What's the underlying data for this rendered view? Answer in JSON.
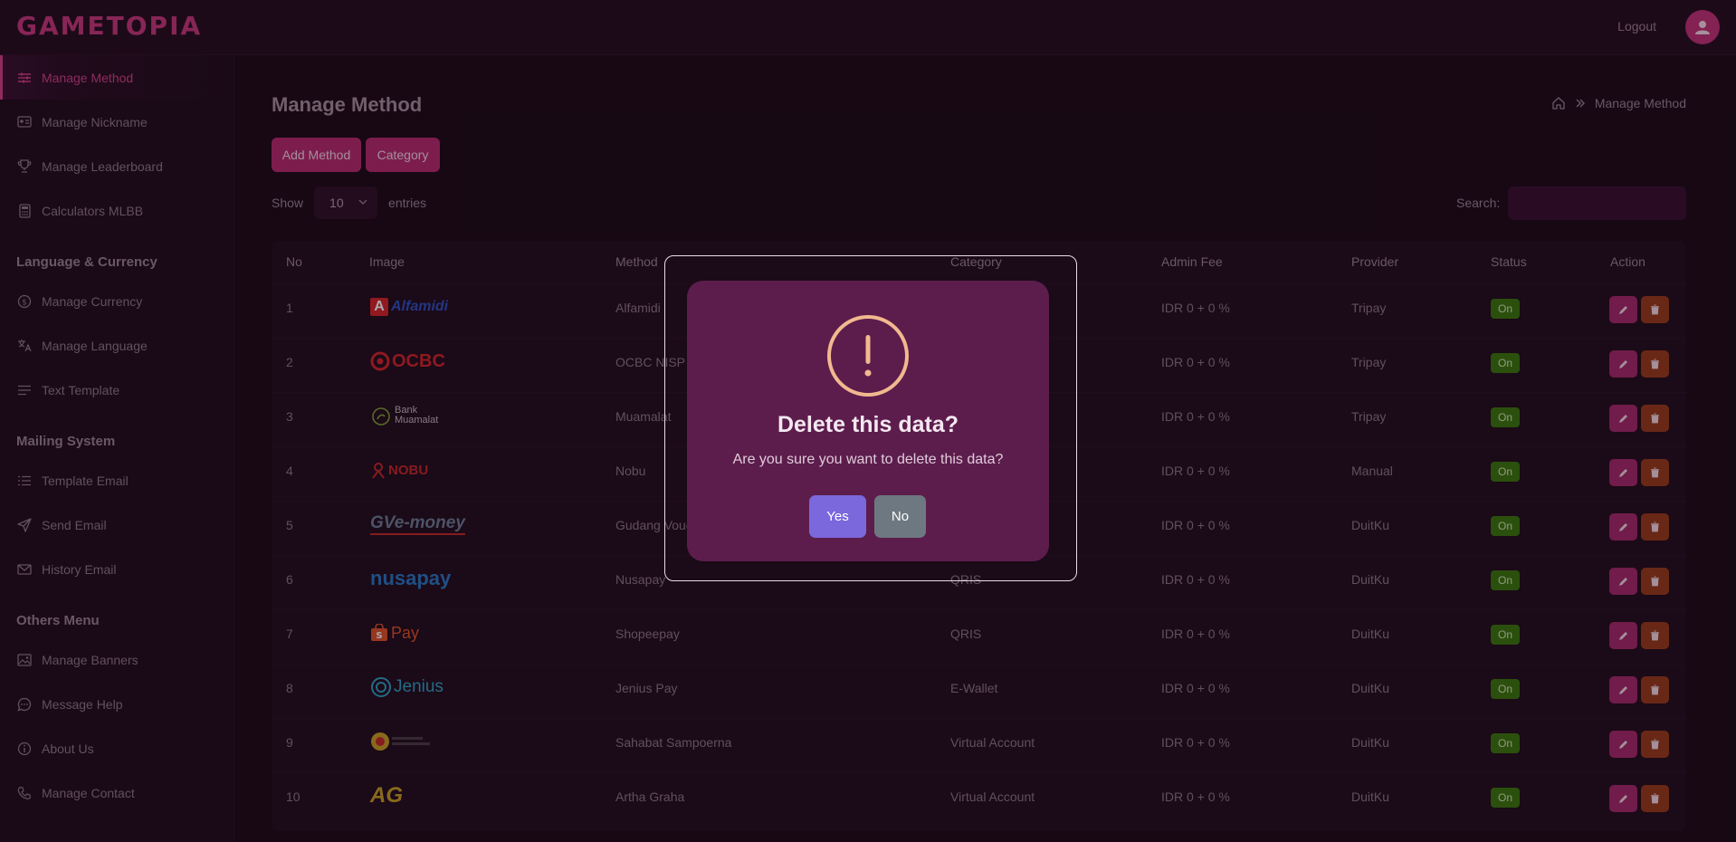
{
  "header": {
    "logo": "GAMETOPIA",
    "logout": "Logout",
    "avatar_icon": "user-icon"
  },
  "sidebar": {
    "items": [
      {
        "label": "Manage Method",
        "icon": "sliders-icon",
        "active": true
      },
      {
        "label": "Manage Nickname",
        "icon": "id-card-icon"
      },
      {
        "label": "Manage Leaderboard",
        "icon": "trophy-icon"
      },
      {
        "label": "Calculators MLBB",
        "icon": "calculator-icon"
      }
    ],
    "section_language": "Language & Currency",
    "language_items": [
      {
        "label": "Manage Currency",
        "icon": "dollar-circle-icon"
      },
      {
        "label": "Manage Language",
        "icon": "translate-icon"
      },
      {
        "label": "Text Template",
        "icon": "text-lines-icon"
      }
    ],
    "section_mailing": "Mailing System",
    "mailing_items": [
      {
        "label": "Template Email",
        "icon": "list-icon"
      },
      {
        "label": "Send Email",
        "icon": "send-icon"
      },
      {
        "label": "History Email",
        "icon": "mail-icon"
      }
    ],
    "section_others": "Others Menu",
    "others_items": [
      {
        "label": "Manage Banners",
        "icon": "image-icon"
      },
      {
        "label": "Message Help",
        "icon": "chat-icon"
      },
      {
        "label": "About Us",
        "icon": "info-icon"
      },
      {
        "label": "Manage Contact",
        "icon": "phone-icon"
      }
    ]
  },
  "main": {
    "title": "Manage Method",
    "breadcrumb": {
      "current": "Manage Method"
    },
    "add_button": "Add Method",
    "category_button": "Category",
    "show_label": "Show",
    "entries_value": "10",
    "entries_label": "entries",
    "search_label": "Search:",
    "search_value": ""
  },
  "table": {
    "columns": [
      "No",
      "Image",
      "Method",
      "Category",
      "Admin Fee",
      "Provider",
      "Status",
      "Action"
    ],
    "rows": [
      {
        "no": "1",
        "logo": "Alfamidi",
        "method": "Alfamidi",
        "category": "",
        "fee": "IDR 0 + 0 %",
        "provider": "Tripay",
        "status": "On"
      },
      {
        "no": "2",
        "logo": "OCBC",
        "method": "OCBC NISP",
        "category": "",
        "fee": "IDR 0 + 0 %",
        "provider": "Tripay",
        "status": "On"
      },
      {
        "no": "3",
        "logo": "Bank Muamalat",
        "method": "Muamalat",
        "category": "",
        "fee": "IDR 0 + 0 %",
        "provider": "Tripay",
        "status": "On"
      },
      {
        "no": "4",
        "logo": "NOBU",
        "method": "Nobu",
        "category": "",
        "fee": "IDR 0 + 0 %",
        "provider": "Manual",
        "status": "On"
      },
      {
        "no": "5",
        "logo": "GVe-money",
        "method": "Gudang Vouc",
        "category": "",
        "fee": "IDR 0 + 0 %",
        "provider": "DuitKu",
        "status": "On"
      },
      {
        "no": "6",
        "logo": "nusapay",
        "method": "Nusapay",
        "category": "QRIS",
        "fee": "IDR 0 + 0 %",
        "provider": "DuitKu",
        "status": "On"
      },
      {
        "no": "7",
        "logo": "Pay",
        "method": "Shopeepay",
        "category": "QRIS",
        "fee": "IDR 0 + 0 %",
        "provider": "DuitKu",
        "status": "On"
      },
      {
        "no": "8",
        "logo": "Jenius",
        "method": "Jenius Pay",
        "category": "E-Wallet",
        "fee": "IDR 0 + 0 %",
        "provider": "DuitKu",
        "status": "On"
      },
      {
        "no": "9",
        "logo": "",
        "method": "Sahabat Sampoerna",
        "category": "Virtual Account",
        "fee": "IDR 0 + 0 %",
        "provider": "DuitKu",
        "status": "On"
      },
      {
        "no": "10",
        "logo": "AG",
        "method": "Artha Graha",
        "category": "Virtual Account",
        "fee": "IDR 0 + 0 %",
        "provider": "DuitKu",
        "status": "On"
      }
    ]
  },
  "modal": {
    "icon": "exclamation-icon",
    "title": "Delete this data?",
    "text": "Are you sure you want to delete this data?",
    "yes": "Yes",
    "no": "No"
  },
  "colors": {
    "accent": "#b82b72",
    "status_on": "#3b7a0e",
    "delete": "#9a3d1d",
    "modal_bg": "#5c1d4d",
    "confirm": "#7a68dc"
  }
}
